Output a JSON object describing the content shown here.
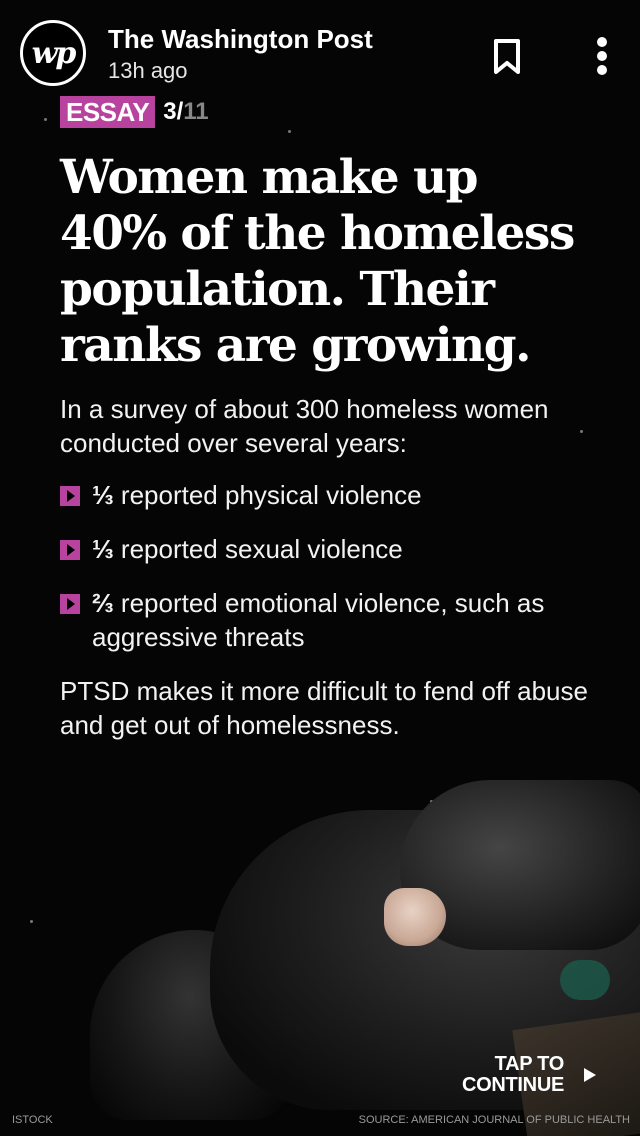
{
  "header": {
    "logo_text": "wp",
    "publisher": "The Washington Post",
    "time_ago": "13h ago",
    "bookmark_icon": "bookmark-icon",
    "more_icon": "more-vertical-icon"
  },
  "card": {
    "tag": "ESSAY",
    "page_current": "3/",
    "page_total": "11",
    "headline": "Women make up 40% of the homeless population. Their ranks are growing.",
    "intro": "In a survey of about 300 homeless women conducted over several years:",
    "stats": [
      {
        "fraction": "⅓",
        "text": "reported physical violence"
      },
      {
        "fraction": "⅓",
        "text": "reported sexual violence"
      },
      {
        "fraction": "⅔",
        "text": "reported emotional violence, such as aggressive threats"
      }
    ],
    "closing": "PTSD makes it more difficult to fend off abuse and get out of homelessness."
  },
  "footer": {
    "tap_label": "TAP TO CONTINUE",
    "photo_credit": "ISTOCK",
    "source": "SOURCE: AMERICAN JOURNAL OF PUBLIC HEALTH"
  },
  "colors": {
    "accent": "#b8439f",
    "background": "#050505"
  }
}
